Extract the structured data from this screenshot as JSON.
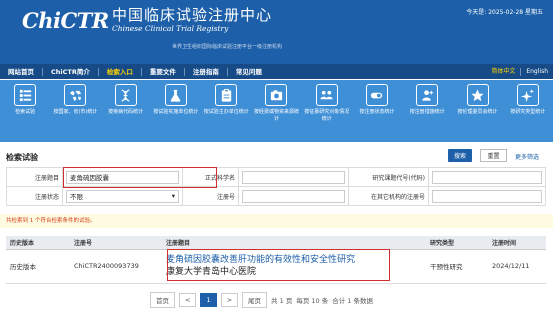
{
  "header": {
    "logo": "ChiCTR",
    "title_cn": "中国临床试验注册中心",
    "title_en": "Chinese Clinical Trial Registry",
    "subtitle": "世界卫生组织国际临床试验注册平台一级注册机构",
    "date": "今天是: 2025-02-28 星期五"
  },
  "nav": {
    "items": [
      "网站首页",
      "ChiCTR简介",
      "检索入口",
      "重要文件",
      "注册指南",
      "常见问题"
    ],
    "active_index": 2,
    "lang_cn": "简体中文",
    "lang_en": "English"
  },
  "iconbar": {
    "items": [
      {
        "label": "检索试验",
        "icon": "list-icon"
      },
      {
        "label": "按国家、省(市)统计",
        "icon": "world-map-icon"
      },
      {
        "label": "按疾病代码统计",
        "icon": "dna-icon"
      },
      {
        "label": "按试验实施单位统计",
        "icon": "flask-icon"
      },
      {
        "label": "按试验主办单位统计",
        "icon": "clipboard-icon"
      },
      {
        "label": "按经费或物资来源统计",
        "icon": "camera-icon"
      },
      {
        "label": "按征募研究对象情况统计",
        "icon": "group-icon"
      },
      {
        "label": "按注册状态统计",
        "icon": "toggle-icon"
      },
      {
        "label": "按注册措施统计",
        "icon": "user-add-icon"
      },
      {
        "label": "按伦理委员会统计",
        "icon": "star-icon"
      },
      {
        "label": "按研究类型统计",
        "icon": "sparkle-icon"
      }
    ]
  },
  "search": {
    "section_title": "检索试验",
    "search_btn": "搜索",
    "reset_btn": "重置",
    "more_filter": "更多筛选",
    "fields": {
      "reg_title_label": "注册题目",
      "reg_title_value": "麦角硫因胶囊",
      "sci_title_label": "正式科学名",
      "sci_title_value": "",
      "project_code_label": "研究课题代号(代码)",
      "project_code_value": "",
      "reg_status_label": "注册状态",
      "reg_status_value": "不限",
      "reg_no_label": "注册号",
      "reg_no_value": "",
      "other_reg_label": "在其它机构的注册号",
      "other_reg_value": ""
    }
  },
  "results": {
    "notice": "共检索到 1 个符合检索条件的试验。",
    "headers": {
      "history": "历史版本",
      "reg_no": "注册号",
      "title": "注册题目",
      "type": "研究类型",
      "time": "注册时间"
    },
    "rows": [
      {
        "history": "历史版本",
        "reg_no": "ChiCTR2400093739",
        "title": "麦角硫因胶囊改善肝功能的有效性和安全性研究",
        "institution": "康复大学青岛中心医院",
        "type": "干预性研究",
        "time": "2024/12/11"
      }
    ]
  },
  "pager": {
    "first": "首页",
    "prev": "<",
    "current": "1",
    "next": ">",
    "last": "尾页",
    "total_pages": "共 1 页",
    "per_page": "每页 10 条",
    "total_count": "合计 1 条数据"
  },
  "colors": {
    "header_bg": "#1d5fa8",
    "nav_bg": "#164b88",
    "iconbar_bg": "#3f8fd6",
    "nav_active": "#ffd400",
    "highlight": "#d12d2d"
  }
}
